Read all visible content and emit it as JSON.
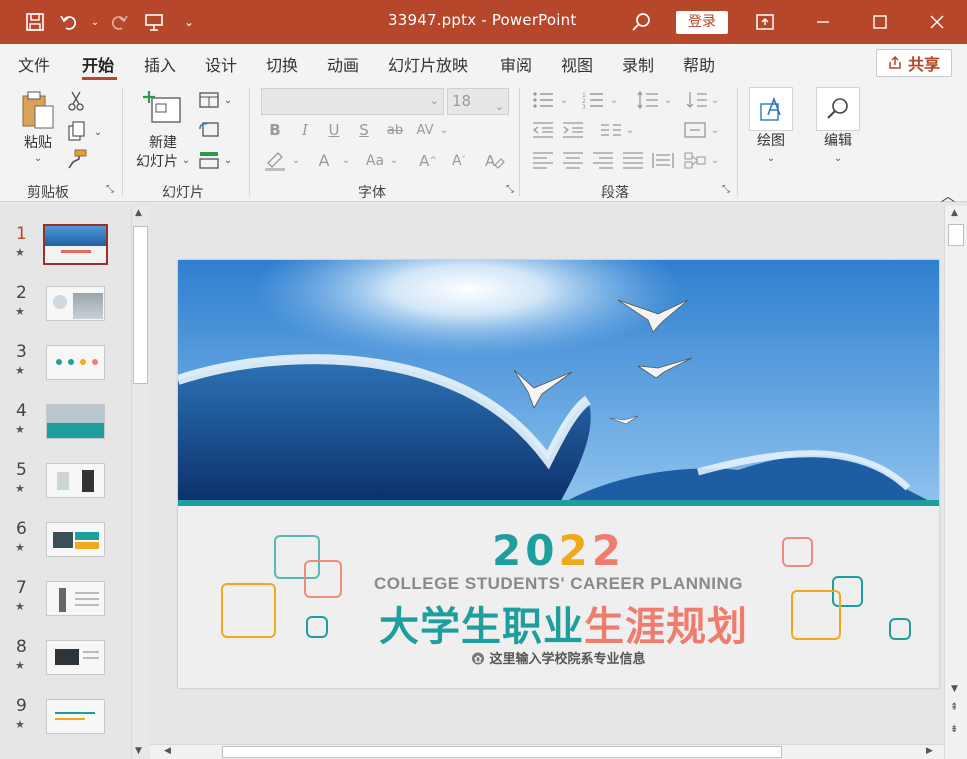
{
  "titlebar": {
    "title": "33947.pptx  -  PowerPoint",
    "login_label": "登录"
  },
  "menubar": {
    "items": [
      "文件",
      "开始",
      "插入",
      "设计",
      "切换",
      "动画",
      "幻灯片放映",
      "审阅",
      "视图",
      "录制",
      "帮助"
    ],
    "share_label": "共享"
  },
  "ribbon": {
    "paste_label": "粘贴",
    "new_slide_label_1": "新建",
    "new_slide_label_2": "幻灯片",
    "font_size_value": "18",
    "draw_label": "绘图",
    "edit_label": "编辑",
    "groups": [
      "剪贴板",
      "幻灯片",
      "字体",
      "段落"
    ]
  },
  "thumbnails": [
    "1",
    "2",
    "3",
    "4",
    "5",
    "6",
    "7",
    "8",
    "9"
  ],
  "slide": {
    "year_digits": [
      "2",
      "0",
      "2",
      "2"
    ],
    "english_title": "COLLEGE STUDENTS' CAREER  PLANNING",
    "chinese_title_part1": "大学生职业",
    "chinese_title_part2": "生涯规划",
    "info_text": "这里输入学校院系专业信息"
  },
  "colors": {
    "accent": "#b7472a",
    "teal": "#1e9e9c",
    "orange": "#f2a81d",
    "coral": "#ef7d6f"
  }
}
